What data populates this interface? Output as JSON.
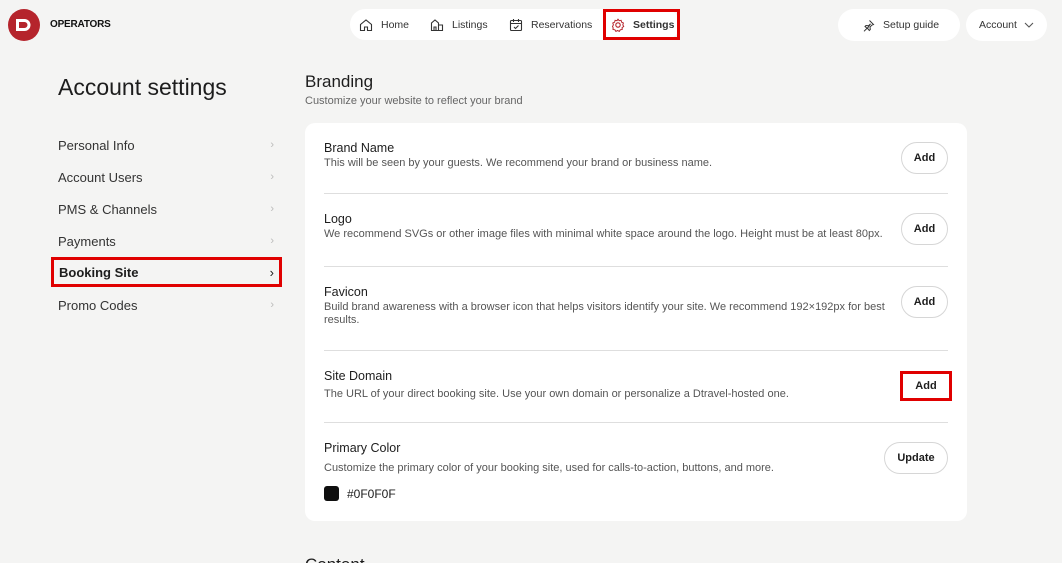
{
  "brand": {
    "logo_letter": "D",
    "name": "OPERATORS",
    "color": "#b5242c"
  },
  "nav": {
    "items": [
      {
        "label": "Home",
        "icon": "home-icon"
      },
      {
        "label": "Listings",
        "icon": "listings-icon"
      },
      {
        "label": "Reservations",
        "icon": "calendar-icon"
      },
      {
        "label": "Settings",
        "icon": "gear-icon"
      }
    ]
  },
  "header": {
    "setup_guide": "Setup guide",
    "account": "Account"
  },
  "sidebar": {
    "title": "Account settings",
    "items": [
      {
        "label": "Personal Info"
      },
      {
        "label": "Account Users"
      },
      {
        "label": "PMS & Channels"
      },
      {
        "label": "Payments"
      },
      {
        "label": "Booking Site"
      },
      {
        "label": "Promo Codes"
      }
    ]
  },
  "branding": {
    "title": "Branding",
    "subtitle": "Customize your website to reflect your brand",
    "rows": [
      {
        "title": "Brand Name",
        "desc": "This will be seen by your guests. We recommend your brand or business name.",
        "button": "Add"
      },
      {
        "title": "Logo",
        "desc": "We recommend SVGs or other image files with minimal white space around the logo. Height must be at least 80px.",
        "button": "Add"
      },
      {
        "title": "Favicon",
        "desc": "Build brand awareness with a browser icon that helps visitors identify your site. We recommend 192×192px for best results.",
        "button": "Add"
      },
      {
        "title": "Site Domain",
        "desc": "The URL of your direct booking site. Use your own domain or personalize a Dtravel-hosted one.",
        "button": "Add"
      },
      {
        "title": "Primary Color",
        "desc": "Customize the primary color of your booking site, used for calls-to-action, buttons, and more.",
        "button": "Update"
      }
    ],
    "primary_color_value": "#0F0F0F"
  },
  "next_section": {
    "title": "Content"
  },
  "colors": {
    "highlight": "#e00000",
    "accent": "#b5242c",
    "swatch": "#0f0f0f"
  }
}
